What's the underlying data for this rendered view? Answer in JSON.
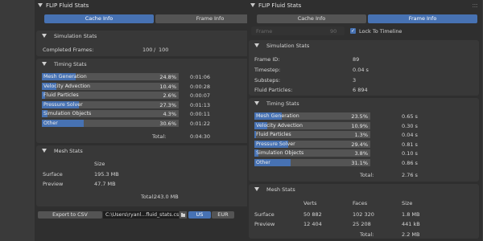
{
  "left": {
    "title": "FLIP Fluid Stats",
    "tabs": [
      "Cache Info",
      "Frame Info"
    ],
    "sim": {
      "title": "Simulation Stats",
      "completed_label": "Completed Frames:",
      "completed_value": "100",
      "completed_sep": "/",
      "completed_total": "100"
    },
    "timing": {
      "title": "Timing Stats",
      "rows": [
        {
          "label": "Mesh Generation",
          "pct": "24.8%",
          "time": "0:01:06",
          "fill": 0.248
        },
        {
          "label": "Velocity Advection",
          "pct": "10.4%",
          "time": "0:00:28",
          "fill": 0.104
        },
        {
          "label": "Fluid Particles",
          "pct": "2.6%",
          "time": "0:00:07",
          "fill": 0.026
        },
        {
          "label": "Pressure Solver",
          "pct": "27.3%",
          "time": "0:01:13",
          "fill": 0.273
        },
        {
          "label": "Simulation Objects",
          "pct": "4.3%",
          "time": "0:00:11",
          "fill": 0.043
        },
        {
          "label": "Other",
          "pct": "30.6%",
          "time": "0:01:22",
          "fill": 0.306
        }
      ],
      "total_label": "Total:",
      "total_value": "0:04:30"
    },
    "mesh": {
      "title": "Mesh Stats",
      "size_header": "Size",
      "rows": [
        {
          "label": "Surface",
          "size": "195.3 MB"
        },
        {
          "label": "Preview",
          "size": "47.7 MB"
        }
      ],
      "total_label": "Total:",
      "total_value": "243.0 MB"
    },
    "export": {
      "button": "Export to CSV",
      "path": "C:\\Users\\ryanl...fluid_stats.csv",
      "us": "US",
      "eur": "EUR"
    }
  },
  "right": {
    "title": "FLIP Fluid Stats",
    "tabs": [
      "Cache Info",
      "Frame Info"
    ],
    "frame_label": "Frame",
    "frame_value": "90",
    "lock_label": "Lock To Timeline",
    "sim": {
      "title": "Simulation Stats",
      "rows": [
        {
          "label": "Frame ID:",
          "value": "89"
        },
        {
          "label": "Timestep:",
          "value": "0.04 s"
        },
        {
          "label": "Substeps:",
          "value": "3"
        },
        {
          "label": "Fluid Particles:",
          "value": "6 894"
        }
      ]
    },
    "timing": {
      "title": "Timing Stats",
      "rows": [
        {
          "label": "Mesh Generation",
          "pct": "23.5%",
          "time": "0.65 s",
          "fill": 0.235
        },
        {
          "label": "Velocity Advection",
          "pct": "10.9%",
          "time": "0.30 s",
          "fill": 0.109
        },
        {
          "label": "Fluid Particles",
          "pct": "1.3%",
          "time": "0.04 s",
          "fill": 0.013
        },
        {
          "label": "Pressure Solver",
          "pct": "29.4%",
          "time": "0.81 s",
          "fill": 0.294
        },
        {
          "label": "Simulation Objects",
          "pct": "3.8%",
          "time": "0.10 s",
          "fill": 0.038
        },
        {
          "label": "Other",
          "pct": "31.1%",
          "time": "0.86 s",
          "fill": 0.311
        }
      ],
      "total_label": "Total:",
      "total_value": "2.76 s"
    },
    "mesh": {
      "title": "Mesh Stats",
      "headers": [
        "Verts",
        "Faces",
        "Size"
      ],
      "rows": [
        {
          "label": "Surface",
          "verts": "50 882",
          "faces": "102 320",
          "size": "1.8 MB"
        },
        {
          "label": "Preview",
          "verts": "12 404",
          "faces": "25 208",
          "size": "441 kB"
        }
      ],
      "total_label": "Total:",
      "total_value": "2.2 MB"
    }
  }
}
